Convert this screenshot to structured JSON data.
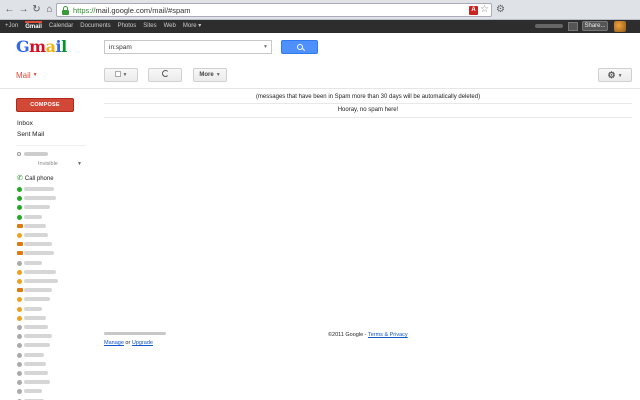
{
  "browser": {
    "url_scheme": "https://",
    "url_rest": "mail.google.com/mail/#spam",
    "back_icon": "←",
    "forward_icon": "→",
    "reload_icon": "↻",
    "home_icon": "⌂",
    "ext_label": "A"
  },
  "gbar": {
    "links": [
      "+Jon",
      "Gmail",
      "Calendar",
      "Documents",
      "Photos",
      "Sites",
      "Web",
      "More ▾"
    ],
    "share_label": "Share..."
  },
  "header": {
    "logo_letters": [
      "G",
      "m",
      "a",
      "i",
      "l"
    ],
    "search_value": "in:spam"
  },
  "toolbar": {
    "mail_label": "Mail",
    "more_label": "More",
    "caret": "▼"
  },
  "sidebar": {
    "compose_label": "COMPOSE",
    "nav": [
      "Inbox",
      "Sent Mail"
    ],
    "status_label": "Invisible",
    "call_label": "Call phone"
  },
  "main": {
    "notice": "(messages that have been in Spam more than 30 days will be automatically deleted)",
    "empty": "Hooray, no spam here!"
  },
  "footer": {
    "manage": "Manage",
    "or": " or ",
    "upgrade": "Upgrade",
    "copyright": "©2011 Google - ",
    "terms": "Terms & Privacy"
  },
  "colors": {
    "online": "#22aa22",
    "idle": "#f0a020",
    "video": "#e07a10",
    "offline": "#aaaaaa"
  }
}
